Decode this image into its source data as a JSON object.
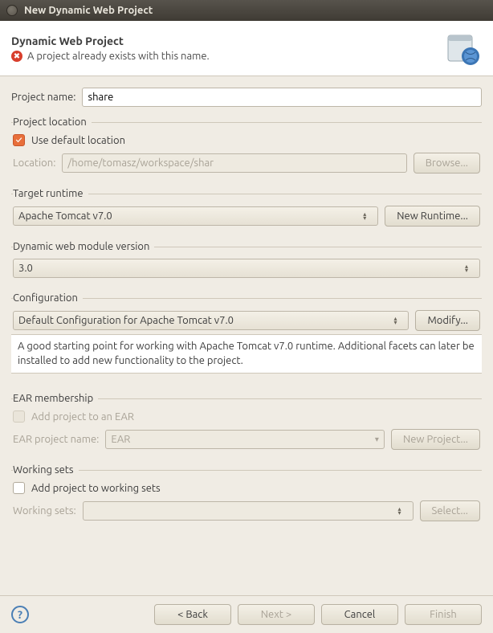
{
  "titlebar": {
    "title": "New Dynamic Web Project"
  },
  "banner": {
    "heading": "Dynamic Web Project",
    "error": "A project already exists with this name."
  },
  "project_name": {
    "label": "Project name:",
    "value": "share"
  },
  "project_location": {
    "legend": "Project location",
    "use_default_label": "Use default location",
    "use_default_checked": true,
    "location_label": "Location:",
    "location_value": "/home/tomasz/workspace/shar",
    "browse": "Browse..."
  },
  "target_runtime": {
    "legend": "Target runtime",
    "value": "Apache Tomcat v7.0",
    "new_btn": "New Runtime..."
  },
  "module_version": {
    "legend": "Dynamic web module version",
    "value": "3.0"
  },
  "configuration": {
    "legend": "Configuration",
    "value": "Default Configuration for Apache Tomcat v7.0",
    "modify_btn": "Modify...",
    "description": "A good starting point for working with Apache Tomcat v7.0 runtime. Additional facets can later be installed to add new functionality to the project."
  },
  "ear": {
    "legend": "EAR membership",
    "add_label": "Add project to an EAR",
    "name_label": "EAR project name:",
    "name_value": "EAR",
    "new_btn": "New Project..."
  },
  "working_sets": {
    "legend": "Working sets",
    "add_label": "Add project to working sets",
    "ws_label": "Working sets:",
    "select_btn": "Select..."
  },
  "footer": {
    "back": "< Back",
    "next": "Next >",
    "cancel": "Cancel",
    "finish": "Finish"
  }
}
